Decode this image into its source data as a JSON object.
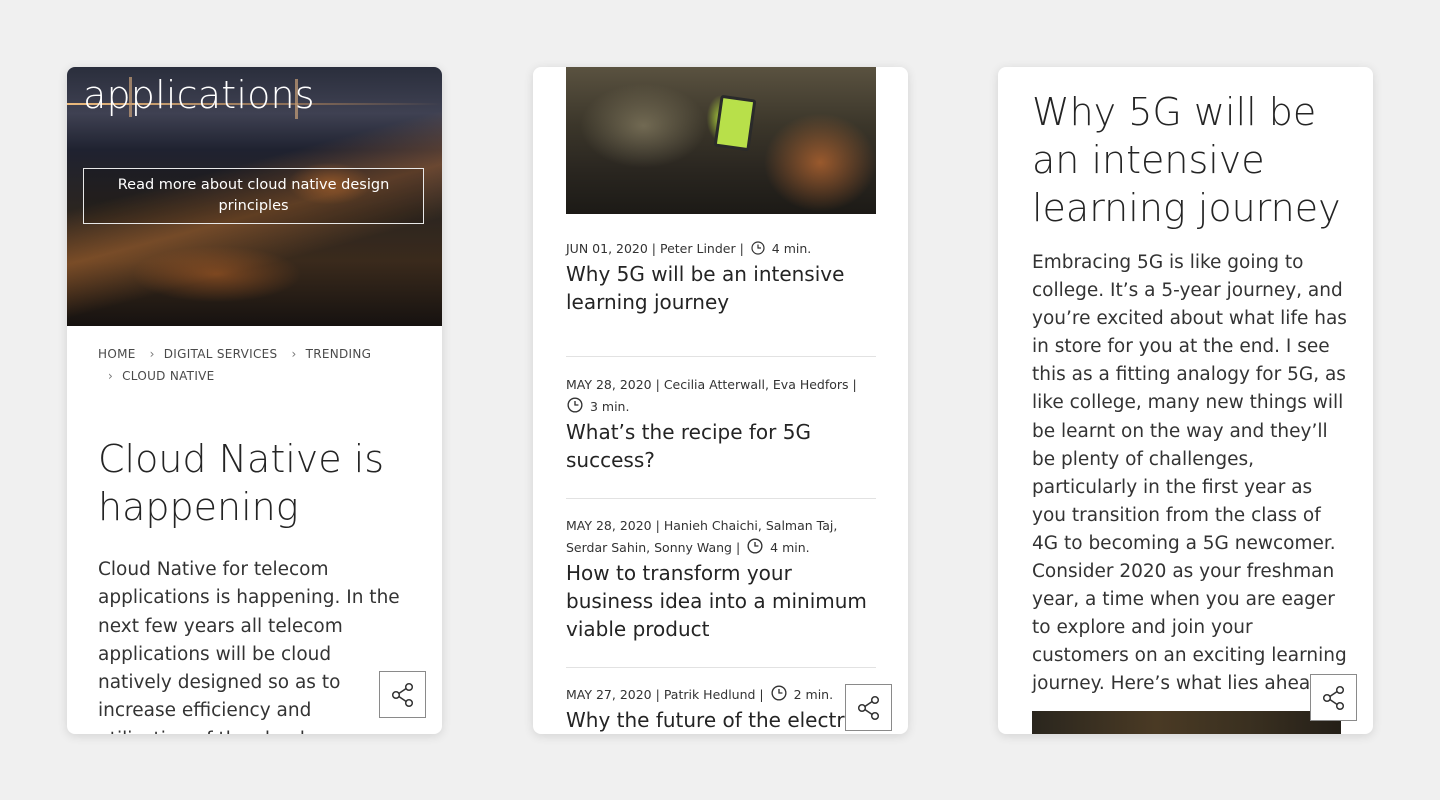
{
  "card1": {
    "hero_headline": "applications",
    "hero_button": "Read more about cloud native design principles",
    "breadcrumb": [
      "HOME",
      "DIGITAL SERVICES",
      "TRENDING",
      "CLOUD NATIVE"
    ],
    "title": "Cloud Native is happening",
    "intro": "Cloud Native for telecom applications is happening. In the next few years all telecom applications will be cloud natively designed so as to increase efficiency and utilization of the cloud infrastructure"
  },
  "card2": {
    "articles": [
      {
        "date": "JUN 01, 2020",
        "authors": "Peter Linder",
        "read": "4 min.",
        "title": "Why 5G will be an intensive learning journey"
      },
      {
        "date": "MAY 28, 2020",
        "authors": "Cecilia Atterwall, Eva Hedfors",
        "read": "3 min.",
        "title": "What’s the recipe for 5G success?"
      },
      {
        "date": "MAY 28, 2020",
        "authors": "Hanieh Chaichi, Salman Taj, Serdar Sahin, Sonny Wang",
        "read": "4 min.",
        "title": "How to transform your business idea into a minimum viable product"
      },
      {
        "date": "MAY 27, 2020",
        "authors": "Patrik Hedlund",
        "read": "2 min.",
        "title": "Why the future of the electric"
      }
    ]
  },
  "card3": {
    "title": "Why 5G will be an intensive learning journey",
    "body": "Embracing 5G is like going to college. It’s a 5-year journey, and you’re excited about what life has in store for you at the end. I see this as a fitting analogy for 5G, as like college, many new things will be learnt on the way and they’ll be plenty of challenges, particularly in the first year as you transition from the class of 4G to becoming a 5G newcomer. Consider 2020 as your freshman year, a time when you are eager to explore and join your customers on an exciting learning journey. Here’s what lies ahead."
  },
  "icons": {
    "share": "share-icon",
    "clock": "clock-icon"
  }
}
